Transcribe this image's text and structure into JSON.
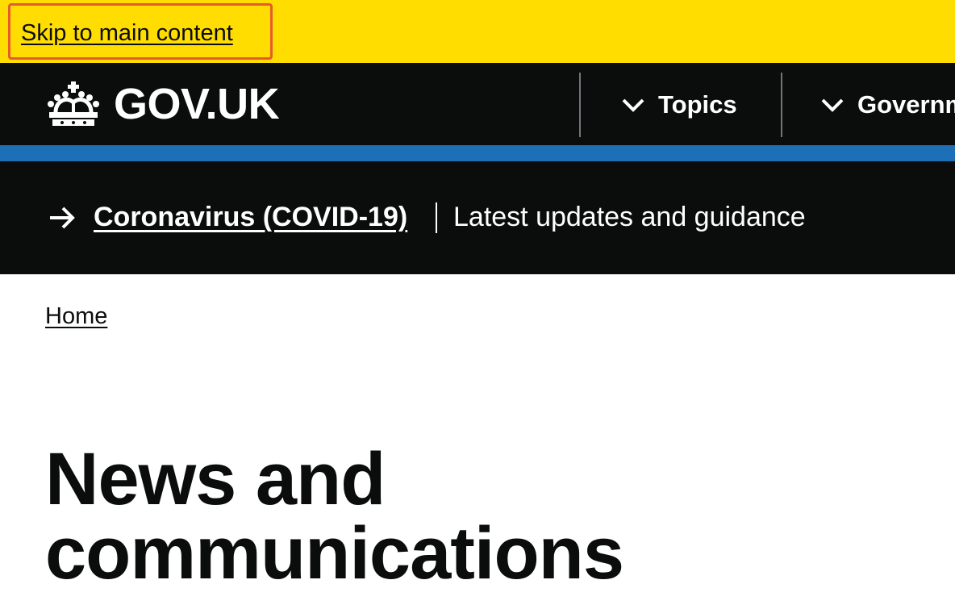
{
  "skip_link": {
    "label": "Skip to main content"
  },
  "header": {
    "logo_text": "GOV.UK",
    "nav": [
      {
        "label": "Topics"
      },
      {
        "label": "Governm"
      }
    ]
  },
  "covid_banner": {
    "link": "Coronavirus (COVID-19)",
    "description": "Latest updates and guidance"
  },
  "breadcrumb": {
    "home": "Home"
  },
  "page": {
    "title": "News and communications"
  },
  "colors": {
    "skip_bar": "#ffdd00",
    "focus_outline": "#e85a2c",
    "header_bg": "#0b0c0c",
    "stripe": "#1d70b8",
    "text": "#0b0c0c"
  }
}
